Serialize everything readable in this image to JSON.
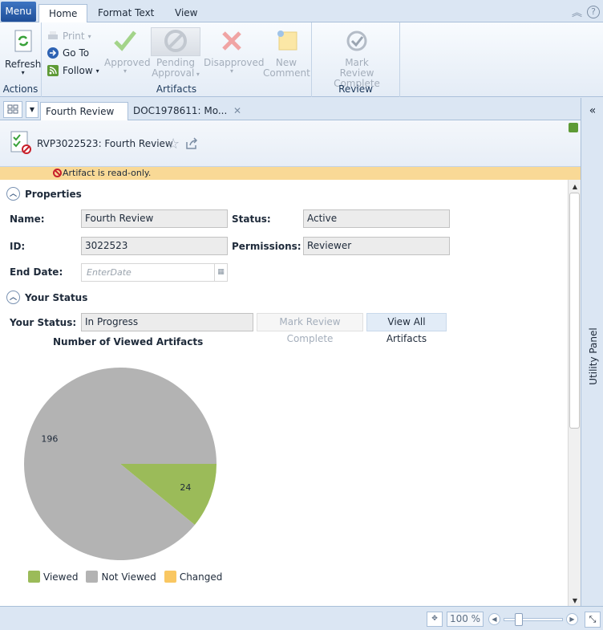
{
  "ribbon_tabs": {
    "menu": "Menu",
    "home": "Home",
    "format_text": "Format Text",
    "view": "View"
  },
  "ribbon": {
    "actions": {
      "refresh": "Refresh",
      "group_label": "Actions"
    },
    "artifacts": {
      "print": "Print",
      "go_to": "Go To",
      "follow": "Follow",
      "approved": "Approved",
      "pending_1": "Pending",
      "pending_2": "Approval",
      "disapproved": "Disapproved",
      "new_1": "New",
      "new_2": "Comment",
      "group_label": "Artifacts"
    },
    "review": {
      "mark_1": "Mark",
      "mark_2": "Review Complete",
      "group_label": "Review"
    }
  },
  "doc_tabs": {
    "tab1": "Fourth Review",
    "tab2": "DOC1978611: Mo..."
  },
  "utility_panel": {
    "label": "Utility Panel",
    "collapse": "«"
  },
  "header": {
    "title": "RVP3022523: Fourth Review"
  },
  "readonly": {
    "message": "Artifact is read-only."
  },
  "properties": {
    "section": "Properties",
    "name_label": "Name:",
    "name_value": "Fourth Review",
    "status_label": "Status:",
    "status_value": "Active",
    "id_label": "ID:",
    "id_value": "3022523",
    "permissions_label": "Permissions:",
    "permissions_value": "Reviewer",
    "end_date_label": "End Date:",
    "end_date_placeholder": "EnterDate"
  },
  "your_status": {
    "section": "Your Status",
    "label": "Your Status:",
    "value": "In Progress",
    "mark_complete": "Mark Review Complete",
    "view_all": "View All Artifacts"
  },
  "chart_data": {
    "type": "pie",
    "title": "Number of Viewed Artifacts",
    "slices": [
      {
        "name": "Viewed",
        "value": 24,
        "color": "#9bbb59"
      },
      {
        "name": "Not Viewed",
        "value": 196,
        "color": "#b3b3b3"
      }
    ],
    "legend": [
      {
        "name": "Viewed",
        "color": "#9bbb59"
      },
      {
        "name": "Not Viewed",
        "color": "#b3b3b3"
      },
      {
        "name": "Changed",
        "color": "#f9c762"
      }
    ],
    "legend_position": "bottom"
  },
  "statusbar": {
    "zoom": "100 %"
  },
  "colors": {
    "accent": "#1f4f99",
    "readonly_bg": "#f9d996"
  }
}
